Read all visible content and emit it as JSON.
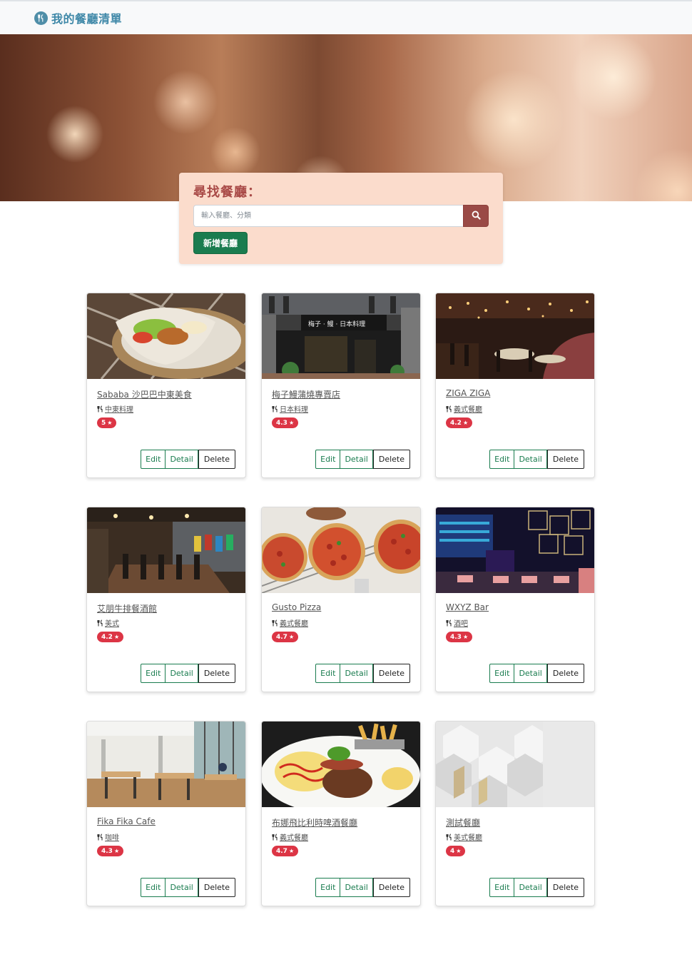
{
  "navbar": {
    "brand": "我的餐廳清單",
    "brand_icon": "utensils-icon"
  },
  "search": {
    "title": "尋找餐廳：",
    "placeholder": "輸入餐廳、分類",
    "value": "",
    "button_icon": "search-icon",
    "add_label": "新增餐廳"
  },
  "colors": {
    "brand": "#3f88a8",
    "search_panel": "#fbdccc",
    "search_title": "#a94a47",
    "search_button": "#9a4a46",
    "accent_green": "#1a7c4f",
    "rating_badge": "#dc3545"
  },
  "buttons": {
    "edit": "Edit",
    "detail": "Detail",
    "delete": "Delete"
  },
  "restaurants": [
    {
      "name": "Sababa 沙巴巴中東美食",
      "category": "中東料理",
      "rating": "5"
    },
    {
      "name": "梅子鰻蒲燒專賣店",
      "category": "日本料理",
      "rating": "4.3"
    },
    {
      "name": "ZIGA ZIGA",
      "category": "義式餐廳",
      "rating": "4.2"
    },
    {
      "name": "艾朋牛排餐酒館",
      "category": "美式",
      "rating": "4.2"
    },
    {
      "name": "Gusto Pizza",
      "category": "義式餐廳",
      "rating": "4.7"
    },
    {
      "name": "WXYZ Bar",
      "category": "酒吧",
      "rating": "4.3"
    },
    {
      "name": "Fika Fika Cafe",
      "category": "咖啡",
      "rating": "4.3"
    },
    {
      "name": "布娜飛比利時啤酒餐廳",
      "category": "義式餐廳",
      "rating": "4.7"
    },
    {
      "name": "測試餐廳",
      "category": "美式餐廳",
      "rating": "4"
    }
  ]
}
